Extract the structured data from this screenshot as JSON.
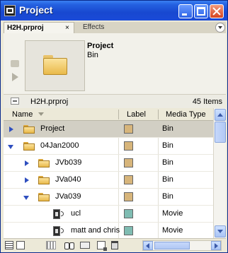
{
  "window": {
    "title": "Project"
  },
  "tabs": [
    {
      "label": "H2H.prproj",
      "close": "×"
    },
    {
      "label": "Effects"
    }
  ],
  "preview": {
    "name": "Project",
    "type": "Bin"
  },
  "info": {
    "project_file": "H2H.prproj",
    "item_count": "45 Items"
  },
  "columns": {
    "name": "Name",
    "label": "Label",
    "media_type": "Media Type"
  },
  "rows": [
    {
      "name": "Project",
      "label_color": "#d7b57b",
      "type": "Bin",
      "kind": "folder",
      "expanded": false,
      "selected": true
    },
    {
      "name": "04Jan2000",
      "label_color": "#d7b57b",
      "type": "Bin",
      "kind": "folder",
      "expanded": true,
      "selected": false
    },
    {
      "name": "JVb039",
      "label_color": "#d7b57b",
      "type": "Bin",
      "kind": "folder",
      "expanded": false,
      "selected": false
    },
    {
      "name": "JVa040",
      "label_color": "#d7b57b",
      "type": "Bin",
      "kind": "folder",
      "expanded": false,
      "selected": false
    },
    {
      "name": "JVa039",
      "label_color": "#d7b57b",
      "type": "Bin",
      "kind": "folder",
      "expanded": true,
      "selected": false
    },
    {
      "name": "ucl",
      "label_color": "#7fbcb2",
      "type": "Movie",
      "kind": "movie",
      "selected": false
    },
    {
      "name": "matt and chris",
      "label_color": "#7fbcb2",
      "type": "Movie",
      "kind": "movie",
      "selected": false
    }
  ],
  "icons": {
    "list_view": "list-view-icon",
    "icon_view": "icon-view-icon",
    "automate": "automate-to-sequence-icon",
    "find": "find-icon",
    "new_bin": "new-bin-icon",
    "new_item": "new-item-icon",
    "clear": "trash-icon"
  }
}
